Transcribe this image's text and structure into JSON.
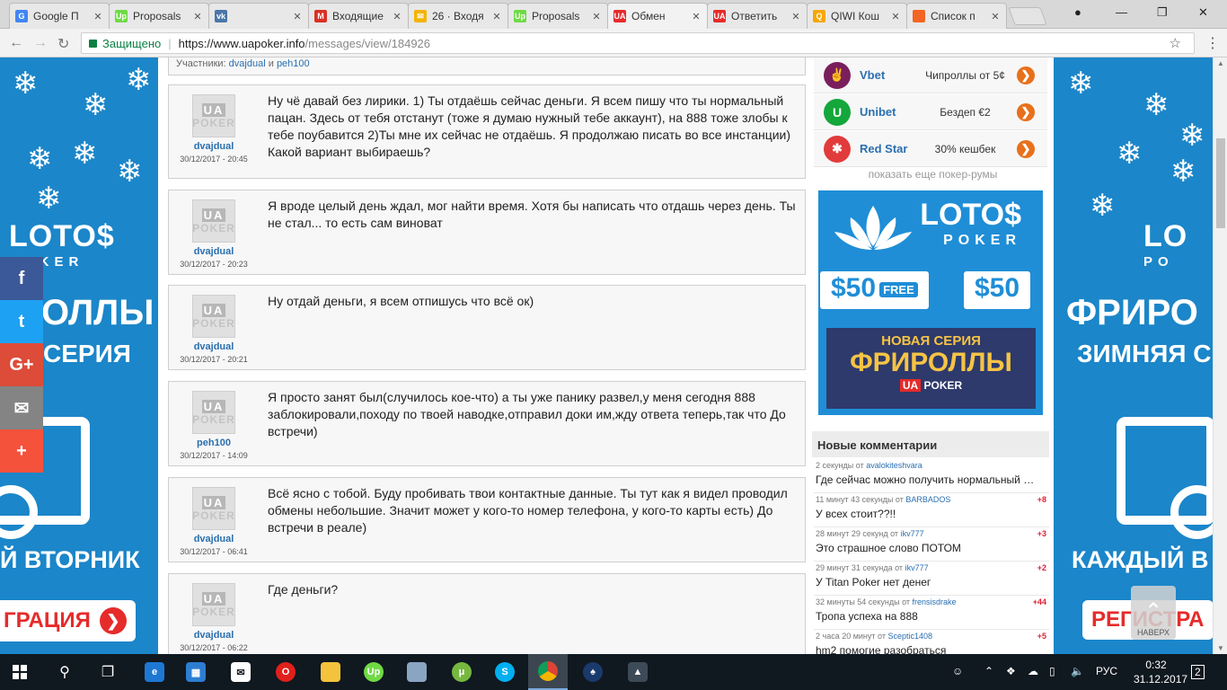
{
  "browser": {
    "tabs": [
      {
        "title": "Google П",
        "color": "#4285f4",
        "glyph": "G"
      },
      {
        "title": "Proposals",
        "color": "#6fda44",
        "glyph": "Up"
      },
      {
        "title": "",
        "color": "#4a76a8",
        "glyph": "vk"
      },
      {
        "title": "Входящие",
        "color": "#d93025",
        "glyph": "M"
      },
      {
        "title": "26 · Входя",
        "color": "#f4b400",
        "glyph": "✉"
      },
      {
        "title": "Proposals",
        "color": "#6fda44",
        "glyph": "Up"
      },
      {
        "title": "Обмен",
        "color": "#e62b2b",
        "glyph": "UA"
      },
      {
        "title": "Ответить",
        "color": "#e62b2b",
        "glyph": "UA"
      },
      {
        "title": "QIWI Кош",
        "color": "#f7a600",
        "glyph": "Q"
      },
      {
        "title": "Список п",
        "color": "#f26522",
        "glyph": ""
      }
    ],
    "active_tab": 6,
    "secure_label": "Защищено",
    "url_host": "https://www.uapoker.info",
    "url_path": "/messages/view/184926"
  },
  "thread": {
    "participants_label": "Участники:",
    "participant_1": "dvajdual",
    "and": "и",
    "participant_2": "peh100",
    "messages": [
      {
        "author": "dvajdual",
        "date": "30/12/2017 - 20:45",
        "text": "Ну чё давай без лирики. 1) Ты отдаёшь сейчас деньги. Я всем пишу что ты нормальный пацан. Здесь от тебя отстанут (тоже я думаю нужный тебе аккаунт), на 888 тоже злобы к тебе поубавится 2)Ты мне их сейчас не отдаёшь. Я продолжаю писать во все инстанции) Какой вариант выбираешь?"
      },
      {
        "author": "dvajdual",
        "date": "30/12/2017 - 20:23",
        "text": "Я вроде целый день ждал, мог найти время. Хотя бы написать что отдашь через день. Ты не стал... то есть сам виноват"
      },
      {
        "author": "dvajdual",
        "date": "30/12/2017 - 20:21",
        "text": "Ну отдай деньги, я всем отпишусь что всё ок)"
      },
      {
        "author": "peh100",
        "date": "30/12/2017 - 14:09",
        "text": "Я просто занят был(случилось кое-что) а ты уже панику развел,у меня сегодня 888 заблокировали,походу по твоей наводке,отправил доки им,жду ответа теперь,так что До встречи)"
      },
      {
        "author": "dvajdual",
        "date": "30/12/2017 - 06:41",
        "text": "Всё ясно с тобой. Буду пробивать твои контактные данные. Ты тут как я видел проводил обмены небольшие. Значит может у кого-то номер телефона, у кого-то карты есть) До встречи в реале)"
      },
      {
        "author": "dvajdual",
        "date": "30/12/2017 - 06:22",
        "text": "Где деньги?"
      }
    ],
    "avatar_ua": "UA",
    "avatar_poker": "POKER"
  },
  "rooms": [
    {
      "name": "Vbet",
      "promo": "Чипроллы от 5¢",
      "color": "#7a1f5c",
      "glyph": "✌"
    },
    {
      "name": "Unibet",
      "promo": "Бездеп €2",
      "color": "#14a73b",
      "glyph": "U"
    },
    {
      "name": "Red Star",
      "promo": "30% кешбек",
      "color": "#e23b3b",
      "glyph": "✱"
    }
  ],
  "more_rooms": "показать еще покер-румы",
  "ad": {
    "logo": "LOTO$",
    "logo_sub": "POKER",
    "chip_1": "$50",
    "chip_free": "FREE",
    "chip_2": "$50",
    "line1": "НОВАЯ СЕРИЯ",
    "line2": "ФРИРОЛЛЫ",
    "brand_ua": "UA",
    "brand_poker": "POKER"
  },
  "comments": {
    "title": "Новые комментарии",
    "from": "от",
    "items": [
      {
        "time": "2 секунды",
        "user": "avalokiteshvara",
        "score": "",
        "text": "Где сейчас можно получить нормальный бонус"
      },
      {
        "time": "11 минут 43 секунды",
        "user": "BARBADOS",
        "score": "+8",
        "text": "У всех стоит??!!"
      },
      {
        "time": "28 минут 29 секунд",
        "user": "ikv777",
        "score": "+3",
        "text": "Это страшное слово ПОТОМ"
      },
      {
        "time": "29 минут 31 секунда",
        "user": "ikv777",
        "score": "+2",
        "text": "У Titan Poker нет денег"
      },
      {
        "time": "32 минуты 54 секунды",
        "user": "frensisdrake",
        "score": "+44",
        "text": "Тропа успеха на 888"
      },
      {
        "time": "2 часа 20 минут",
        "user": "Sceptic1408",
        "score": "+5",
        "text": "hm2 помогие разобраться"
      }
    ]
  },
  "banners": {
    "left": {
      "logo": "LOTO$",
      "logo_sub": "POKER",
      "big": "ОЛЛЫ",
      "mid": "СЕРИЯ",
      "day": "Й ВТОРНИК",
      "reg": "ГРАЦИЯ"
    },
    "right": {
      "logo": "LO",
      "logo_sub": "PO",
      "big": "ФРИРО",
      "mid": "ЗИМНЯЯ С",
      "day": "КАЖДЫЙ В",
      "reg": "РЕГИСТРА"
    }
  },
  "share": [
    {
      "glyph": "f",
      "color": "#3b5998"
    },
    {
      "glyph": "t",
      "color": "#1da1f2"
    },
    {
      "glyph": "G+",
      "color": "#dd4b39"
    },
    {
      "glyph": "✉",
      "color": "#848484"
    },
    {
      "glyph": "+",
      "color": "#f4523b"
    }
  ],
  "to_top": "НАВЕРХ",
  "taskbar": {
    "lang": "РУС",
    "time": "0:32",
    "date": "31.12.2017",
    "notif": "2"
  }
}
